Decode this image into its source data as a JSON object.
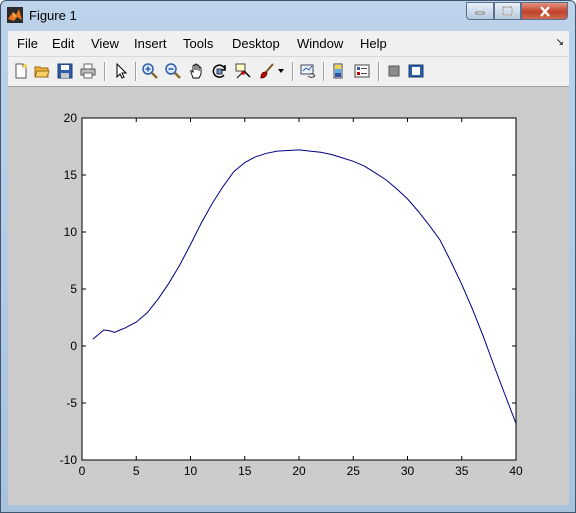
{
  "window": {
    "title": "Figure 1"
  },
  "menu": [
    "File",
    "Edit",
    "View",
    "Insert",
    "Tools",
    "Desktop",
    "Window",
    "Help"
  ],
  "toolbar": {
    "icons": [
      "new-figure-icon",
      "open-file-icon",
      "save-icon",
      "print-icon",
      "edit-plot-arrow-icon",
      "zoom-in-icon",
      "zoom-out-icon",
      "pan-hand-icon",
      "rotate-3d-icon",
      "data-cursor-icon",
      "brush-icon",
      "brush-dropdown-icon",
      "link-plot-icon",
      "colorbar-icon",
      "legend-icon",
      "hide-plot-tools-icon",
      "show-plot-tools-icon"
    ]
  },
  "chart_data": {
    "type": "line",
    "title": "",
    "xlabel": "",
    "ylabel": "",
    "xlim": [
      0,
      40
    ],
    "ylim": [
      -10,
      20
    ],
    "xticks": [
      0,
      5,
      10,
      15,
      20,
      25,
      30,
      35,
      40
    ],
    "yticks": [
      -10,
      -5,
      0,
      5,
      10,
      15,
      20
    ],
    "grid": false,
    "series": [
      {
        "color": "#000080",
        "x": [
          1,
          1.5,
          2,
          2.5,
          3,
          3.5,
          4,
          5,
          6,
          7,
          8,
          9,
          10,
          11,
          12,
          13,
          14,
          15,
          16,
          17,
          18,
          19,
          20,
          21,
          22,
          23,
          24,
          25,
          26,
          27,
          28,
          29,
          30,
          31,
          32,
          33,
          34,
          35,
          36,
          37,
          38,
          39,
          40
        ],
        "y": [
          0.6,
          1.0,
          1.4,
          1.35,
          1.2,
          1.4,
          1.6,
          2.1,
          2.9,
          4.1,
          5.5,
          7.1,
          8.9,
          10.8,
          12.5,
          14.0,
          15.3,
          16.1,
          16.6,
          16.9,
          17.1,
          17.15,
          17.2,
          17.1,
          17.0,
          16.8,
          16.5,
          16.2,
          15.8,
          15.2,
          14.6,
          13.8,
          12.9,
          11.8,
          10.6,
          9.3,
          7.4,
          5.4,
          3.2,
          0.8,
          -1.8,
          -4.3,
          -6.8
        ]
      }
    ]
  }
}
